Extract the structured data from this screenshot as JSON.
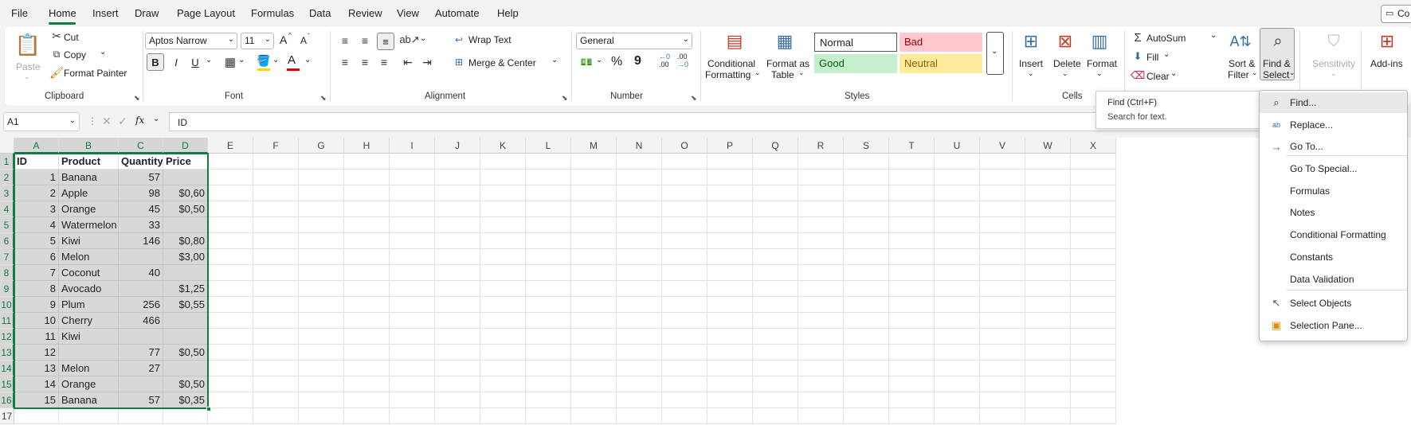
{
  "menu": {
    "items": [
      "File",
      "Home",
      "Insert",
      "Draw",
      "Page Layout",
      "Formulas",
      "Data",
      "Review",
      "View",
      "Automate",
      "Help"
    ],
    "copilot_label": "Co"
  },
  "ribbon": {
    "clipboard": {
      "paste": "Paste",
      "cut": "Cut",
      "copy": "Copy",
      "format_painter": "Format Painter",
      "label": "Clipboard"
    },
    "font": {
      "name": "Aptos Narrow",
      "size": "11",
      "bold": "B",
      "italic": "I",
      "underline": "U",
      "label": "Font",
      "grow": "A",
      "shrink": "A",
      "font_color_glyph": "A"
    },
    "alignment": {
      "wrap": "Wrap Text",
      "merge": "Merge & Center",
      "label": "Alignment"
    },
    "number": {
      "format": "General",
      "percent": "%",
      "comma": "9",
      "label": "Number",
      "dec_inc": ".00",
      "dec_dec": ".00"
    },
    "styles": {
      "cond_1": "Conditional",
      "cond_2": "Formatting",
      "fmt_1": "Format as",
      "fmt_2": "Table",
      "normal": "Normal",
      "bad": "Bad",
      "good": "Good",
      "neutral": "Neutral",
      "label": "Styles"
    },
    "cells": {
      "insert": "Insert",
      "delete": "Delete",
      "format": "Format",
      "label": "Cells"
    },
    "editing": {
      "autosum": "AutoSum",
      "fill": "Fill",
      "clear": "Clear",
      "sort_1": "Sort &",
      "sort_2": "Filter",
      "find_1": "Find &",
      "find_2": "Select"
    },
    "sensitivity": "Sensitivity",
    "addins": "Add-ins"
  },
  "formula_bar": {
    "name_box": "A1",
    "fx": "fx",
    "content": "ID"
  },
  "columns": [
    "A",
    "B",
    "C",
    "D",
    "E",
    "F",
    "G",
    "H",
    "I",
    "J",
    "K",
    "L",
    "M",
    "N",
    "O",
    "P",
    "Q",
    "R",
    "S",
    "T",
    "U",
    "V",
    "W",
    "X"
  ],
  "rows": [
    "1",
    "2",
    "3",
    "4",
    "5",
    "6",
    "7",
    "8",
    "9",
    "10",
    "11",
    "12",
    "13",
    "14",
    "15",
    "16",
    "17"
  ],
  "table": {
    "headers": [
      "ID",
      "Product",
      "Quantity",
      "Price"
    ],
    "data": [
      [
        "1",
        "Banana",
        "57",
        ""
      ],
      [
        "2",
        "Apple",
        "98",
        "$0,60"
      ],
      [
        "3",
        "Orange",
        "45",
        "$0,50"
      ],
      [
        "4",
        "Watermelon",
        "33",
        ""
      ],
      [
        "5",
        "Kiwi",
        "146",
        "$0,80"
      ],
      [
        "6",
        "Melon",
        "",
        "$3,00"
      ],
      [
        "7",
        "Coconut",
        "40",
        ""
      ],
      [
        "8",
        "Avocado",
        "",
        "$1,25"
      ],
      [
        "9",
        "Plum",
        "256",
        "$0,55"
      ],
      [
        "10",
        "Cherry",
        "466",
        ""
      ],
      [
        "11",
        "Kiwi",
        "",
        ""
      ],
      [
        "12",
        "",
        "77",
        "$0,50"
      ],
      [
        "13",
        "Melon",
        "27",
        ""
      ],
      [
        "14",
        "Orange",
        "",
        "$0,50"
      ],
      [
        "15",
        "Banana",
        "57",
        "$0,35"
      ]
    ]
  },
  "tooltip": {
    "title": "Find (Ctrl+F)",
    "desc": "Search for text."
  },
  "find_menu": {
    "items": [
      {
        "label": "Find...",
        "icon": "search-icon"
      },
      {
        "label": "Replace...",
        "icon": "replace-icon"
      },
      {
        "label": "Go To...",
        "icon": "arrow-right-icon"
      },
      {
        "label": "Go To Special...",
        "icon": ""
      },
      {
        "label": "Formulas",
        "icon": ""
      },
      {
        "label": "Notes",
        "icon": ""
      },
      {
        "label": "Conditional Formatting",
        "icon": ""
      },
      {
        "label": "Constants",
        "icon": ""
      },
      {
        "label": "Data Validation",
        "icon": ""
      },
      {
        "label": "Select Objects",
        "icon": "pointer-icon"
      },
      {
        "label": "Selection Pane...",
        "icon": "selection-pane-icon"
      }
    ]
  },
  "colors": {
    "accent": "#107c41",
    "bad_bg": "#ffc7ce",
    "bad_fg": "#9c0006",
    "good_bg": "#c6efce",
    "good_fg": "#006100",
    "neutral_bg": "#ffeb9c",
    "neutral_fg": "#9c5700"
  }
}
